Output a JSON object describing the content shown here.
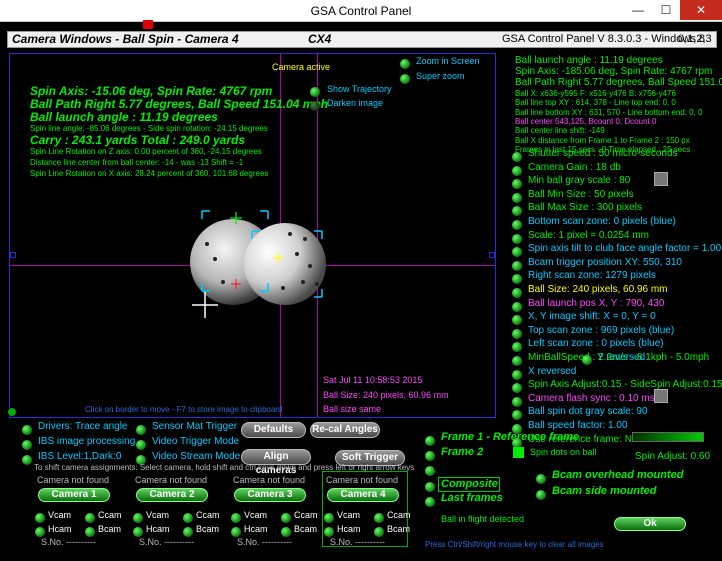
{
  "window": {
    "title": "GSA Control Panel",
    "min": "—",
    "max": "☐",
    "close": "✕"
  },
  "header": {
    "left": "Camera Windows - Ball Spin - Camera 4",
    "center": "CX4",
    "right": "GSA Control Panel V 8.3.0.3 - Windows 8",
    "ids": "0,1,2,3"
  },
  "view": {
    "status": "Camera active",
    "spin_axis": "Spin Axis: -15.06 deg,   Spin Rate: 4767 rpm",
    "ball_path": "Ball Path Right 5.77 degrees, Ball Speed 151.04 mph",
    "launch": "Ball launch angle : 11.19 degrees",
    "spin_line": "Spin line angle: -85.06 degrees - Side spin rotation: -24.15 degrees",
    "carry": "Carry : 243.1 yards  Total : 249.0 yards",
    "rot_z": "Spin Line Rotation on Z axis: 0.00 percent of 360, -24.15 degrees",
    "dist_line": "Distance line center from ball center: -14 - was -13 Shift = -1",
    "rot_x": "Spin Line Rotation on X axis: 28.24 percent of 360, 101.68 degrees",
    "date": "Sat Jul 11 10:58:53 2015",
    "ball_size": "Ball Size: 240 pixels, 60.96 mm",
    "ball_size_same": "Ball size same",
    "hint": "Click on border to move - F7 to store image to clipboard"
  },
  "view_options": {
    "show_trajectory": "Show Trajectory",
    "darken_image": "Darken image",
    "zoom_screen": "Zoom in Screen",
    "super_zoom": "Super zoom"
  },
  "readouts": [
    {
      "text": "Ball launch angle : 11.19 degrees",
      "color": "#00ee00"
    },
    {
      "text": "Spin Axis: -185.06 deg, Spin Rate: 4767 rpm",
      "color": "#00ee00"
    },
    {
      "text": "Ball Path Right 5.77 degrees, Ball Speed 151.04 m",
      "color": "#00ee00"
    }
  ],
  "small_readouts": [
    {
      "text": "Ball X: x636-y595 F: x516-y476 B: x756-y476",
      "color": "#00ee00"
    },
    {
      "text": "Ball line top XY : 614, 378 - Line top end: 0, 0",
      "color": "#00ee00"
    },
    {
      "text": "Ball line bottom XY : 631, 570 - Line bottom end: 0, 0",
      "color": "#00ee00"
    },
    {
      "text": "Ball center 543,125, Bcount 0, Dcount 0",
      "color": "#ff44ff"
    },
    {
      "text": "Ball center line shift: -149",
      "color": "#00ee00"
    },
    {
      "text": "Ball X distance from Frame 1 to Frame 2 : 150 px",
      "color": "#00ee00"
    },
    {
      "text": "Frames in last 15 secs : 0 Time elapsed : 25 secs",
      "color": "#00ee00"
    }
  ],
  "settings": [
    {
      "text": "Shutter speed : 50 micro-seconds",
      "color": "#00ee00",
      "led": true
    },
    {
      "text": "Camera Gain : 18 db",
      "color": "#00ee00",
      "led": true
    },
    {
      "text": "Min ball gray scale : 80",
      "color": "#00ee00",
      "led": true
    },
    {
      "text": "Ball Min Size : 50 pixels",
      "color": "#00ee00",
      "led": true
    },
    {
      "text": "Ball Max Size : 300 pixels",
      "color": "#00ee00",
      "led": true
    },
    {
      "text": "Bottom scan zone: 0 pixels (blue)",
      "color": "#00ccff",
      "led": true
    },
    {
      "text": "Scale: 1 pixel = 0.0254 mm",
      "color": "#00ee00",
      "led": true
    },
    {
      "text": "Spin axis tilt to club face angle factor = 1.00",
      "color": "#00ccff",
      "led": true
    },
    {
      "text": "Bcam trigger position XY: 550, 310",
      "color": "#00ccff",
      "led": true
    },
    {
      "text": "Right scan zone: 1279 pixels",
      "color": "#00ccff",
      "led": true
    },
    {
      "text": "Ball Size: 240 pixels, 60.96 mm",
      "color": "#ffff00",
      "led": true
    },
    {
      "text": "Ball launch pos X, Y : 790, 430",
      "color": "#ff44ff",
      "led": true
    },
    {
      "text": "X, Y image shift: X = 0, Y = 0",
      "color": "#00ccff",
      "led": true
    },
    {
      "text": "Top scan zone : 969 pixels (blue)",
      "color": "#00ccff",
      "led": true
    },
    {
      "text": "Left scan zone : 0 pixels (blue)",
      "color": "#00ccff",
      "led": true
    },
    {
      "text": "MinBallSpeed : 2.2m/s - 8.1kph - 5.0mph",
      "color": "#00ee00",
      "led": true
    },
    {
      "text": "X reversed",
      "color": "#00ccff",
      "led": true
    },
    {
      "text": "Spin Axis Adjust:0.15 - SideSpin Adjust:0.15",
      "color": "#00ee00",
      "led": true
    },
    {
      "text": "Camera flash sync : 0.10 ms",
      "color": "#ff44ff",
      "led": true
    },
    {
      "text": "Ball spin dot gray scale: 90",
      "color": "#00ccff",
      "led": true
    },
    {
      "text": "Ball speed factor: 1.00",
      "color": "#00ccff",
      "led": true
    },
    {
      "text": "Use reference frame: No",
      "color": "#00ee00",
      "led": true
    }
  ],
  "y_reversed": "Y reversed",
  "options_left": {
    "drivers": "Drivers: Trace angle",
    "ibs_processing": "IBS image processing",
    "ibs_level": "IBS Level:1,Dark:0",
    "sensor_mat": "Sensor Mat Trigger",
    "video_trigger": "Video Trigger Mode",
    "video_stream": "Video Stream Mode",
    "shift_hint": "To shift camera assignments: Select camera, hold shift and ctrl keys down and press left or right arrow keys"
  },
  "buttons": {
    "defaults": "Defaults",
    "recal": "Re-cal Angles",
    "align": "Align cameras",
    "soft_trigger": "Soft Trigger",
    "ok": "Ok"
  },
  "cameras": [
    {
      "status": "Camera not found",
      "label": "Camera 1",
      "sno": "S.No. ----------"
    },
    {
      "status": "Camera not found",
      "label": "Camera 2",
      "sno": "S.No. ----------"
    },
    {
      "status": "Camera not found",
      "label": "Camera 3",
      "sno": "S.No. ----------"
    },
    {
      "status": "Camera not found",
      "label": "Camera 4",
      "sno": "S.No. ----------"
    }
  ],
  "cam_options": {
    "vcam": "Vcam",
    "ccam": "Ccam",
    "hcam": "Hcam",
    "bcam": "Bcam"
  },
  "frames": {
    "frame1": "Frame 1 - Reference frame",
    "frame2": "Frame 2",
    "spin_dots": "Spin dots on ball",
    "composite": "Composite",
    "last_frames": "Last frames",
    "ball_flight": "Ball in flight detected",
    "bcam_overhead": "Bcam overhead mounted",
    "bcam_side": "Bcam side mounted",
    "spin_adjust": "Spin Adjust: 0.60",
    "clear_hint": "Press Ctrl/Shift/right mouse key to clear all images"
  }
}
